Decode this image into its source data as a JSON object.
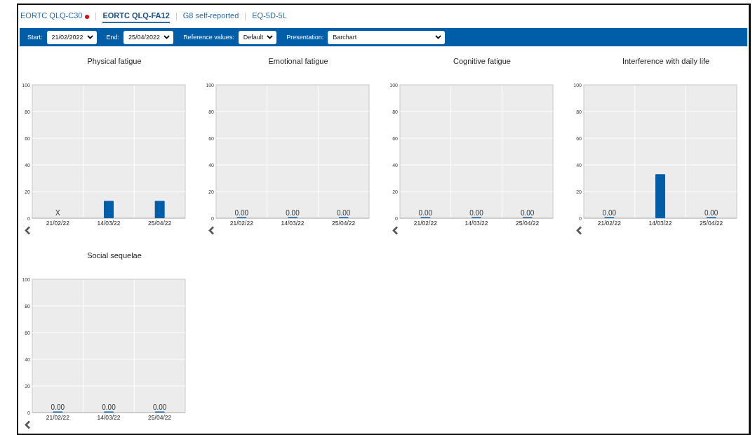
{
  "tabs": [
    {
      "label": "EORTC QLQ-C30",
      "selected": false,
      "alert": true
    },
    {
      "label": "EORTC QLQ-FA12",
      "selected": true,
      "alert": false
    },
    {
      "label": "G8 self-reported",
      "selected": false,
      "alert": false
    },
    {
      "label": "EQ-5D-5L",
      "selected": false,
      "alert": false
    }
  ],
  "toolbar": {
    "start": {
      "label": "Start:",
      "value": "21/02/2022"
    },
    "end": {
      "label": "End:",
      "value": "25/04/2022"
    },
    "reference": {
      "label": "Reference values:",
      "value": "Default"
    },
    "presentation": {
      "label": "Presentation:",
      "value": "Barchart"
    }
  },
  "charts": [
    {
      "chart_data": {
        "type": "bar",
        "title": "Physical fatigue",
        "categories": [
          "21/02/22",
          "14/03/22",
          "25/04/22"
        ],
        "values": [
          null,
          13,
          13
        ],
        "ylim": [
          0,
          100
        ],
        "yticks": [
          0,
          20,
          40,
          60,
          80,
          100
        ],
        "grid": true,
        "value_labels": [
          "X",
          null,
          null
        ]
      }
    },
    {
      "chart_data": {
        "type": "bar",
        "title": "Emotional fatigue",
        "categories": [
          "21/02/22",
          "14/03/22",
          "25/04/22"
        ],
        "values": [
          0,
          0,
          0
        ],
        "ylim": [
          0,
          100
        ],
        "yticks": [
          0,
          20,
          40,
          60,
          80,
          100
        ],
        "grid": true,
        "value_labels": [
          "0.00",
          "0.00",
          "0.00"
        ]
      }
    },
    {
      "chart_data": {
        "type": "bar",
        "title": "Cognitive fatigue",
        "categories": [
          "21/02/22",
          "14/03/22",
          "25/04/22"
        ],
        "values": [
          0,
          0,
          0
        ],
        "ylim": [
          0,
          100
        ],
        "yticks": [
          0,
          20,
          40,
          60,
          80,
          100
        ],
        "grid": true,
        "value_labels": [
          "0.00",
          "0.00",
          "0.00"
        ]
      }
    },
    {
      "chart_data": {
        "type": "bar",
        "title": "Interference with daily life",
        "categories": [
          "21/02/22",
          "14/03/22",
          "25/04/22"
        ],
        "values": [
          0,
          33,
          0
        ],
        "ylim": [
          0,
          100
        ],
        "yticks": [
          0,
          20,
          40,
          60,
          80,
          100
        ],
        "grid": true,
        "value_labels": [
          "0.00",
          null,
          "0.00"
        ]
      }
    },
    {
      "chart_data": {
        "type": "bar",
        "title": "Social sequelae",
        "categories": [
          "21/02/22",
          "14/03/22",
          "25/04/22"
        ],
        "values": [
          0,
          0,
          0
        ],
        "ylim": [
          0,
          100
        ],
        "yticks": [
          0,
          20,
          40,
          60,
          80,
          100
        ],
        "grid": true,
        "value_labels": [
          "0.00",
          "0.00",
          "0.00"
        ]
      }
    }
  ]
}
